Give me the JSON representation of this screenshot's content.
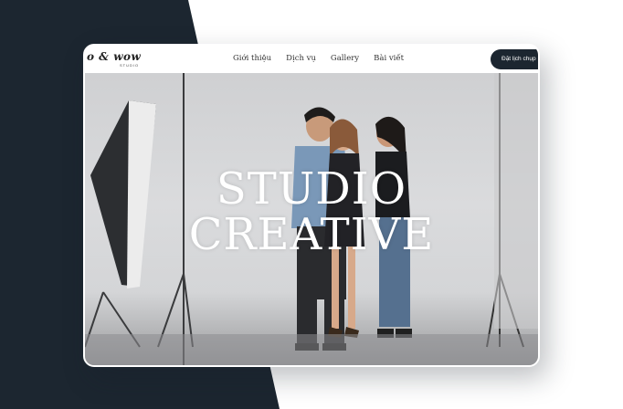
{
  "navbar": {
    "logo_text": "o & wow",
    "logo_subtitle": "STUDIO",
    "links": [
      "Giới thiệu",
      "Dịch vụ",
      "Gallery",
      "Bài viết"
    ],
    "cta_label": "Đặt lịch chụp"
  },
  "hero": {
    "title_line1": "STUDIO",
    "title_line2": "CREATIVE"
  },
  "colors": {
    "dark_panel": "#1c2630",
    "cta_background": "#1c2630",
    "hero_text": "#ffffff"
  }
}
